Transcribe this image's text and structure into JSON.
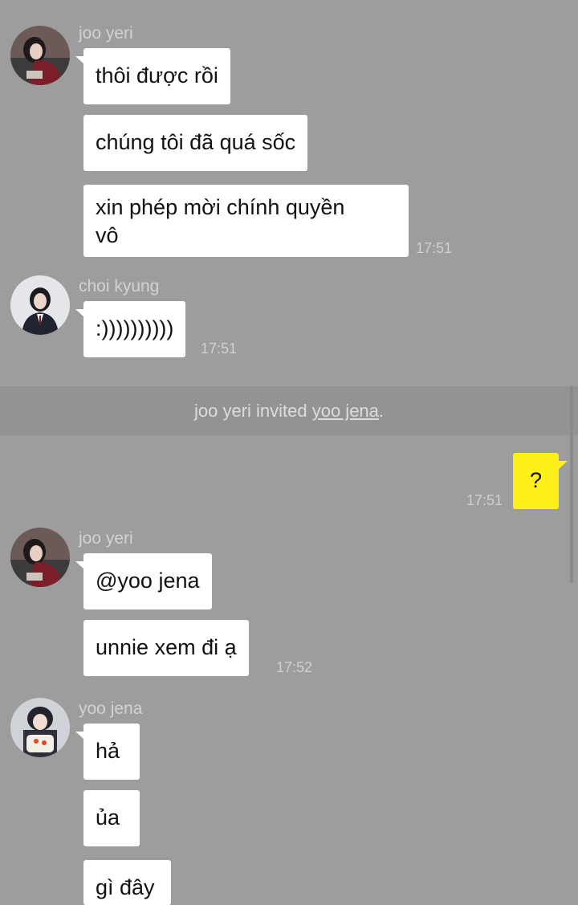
{
  "messages": [
    {
      "sender": "joo yeri",
      "lines": [
        "thôi được rồi",
        "chúng tôi đã quá sốc",
        "xin phép mời chính quyền vô"
      ],
      "time": "17:51"
    },
    {
      "sender": "choi kyung",
      "lines": [
        ":))))))))))"
      ],
      "time": "17:51"
    },
    {
      "sender": "joo yeri",
      "lines": [
        "@yoo jena",
        "unnie xem đi ạ"
      ],
      "time": "17:52"
    },
    {
      "sender": "yoo jena",
      "lines": [
        "hả",
        "ủa",
        "gì đây"
      ]
    }
  ],
  "bubble3_line1": "xin phép mời chính quyền",
  "bubble3_line2": "vô",
  "notice": {
    "inviter": "joo yeri",
    "verb": " invited ",
    "invitee": "yoo jena",
    "end": "."
  },
  "my_message": {
    "text": "?",
    "time": "17:51"
  },
  "colors": {
    "background": "#9d9d9d",
    "my_bubble": "#fef01b",
    "their_bubble": "#ffffff"
  },
  "icons": {
    "avatar_joo_yeri": "profile-photo",
    "avatar_choi_kyung": "profile-photo",
    "avatar_yoo_jena": "profile-photo"
  }
}
